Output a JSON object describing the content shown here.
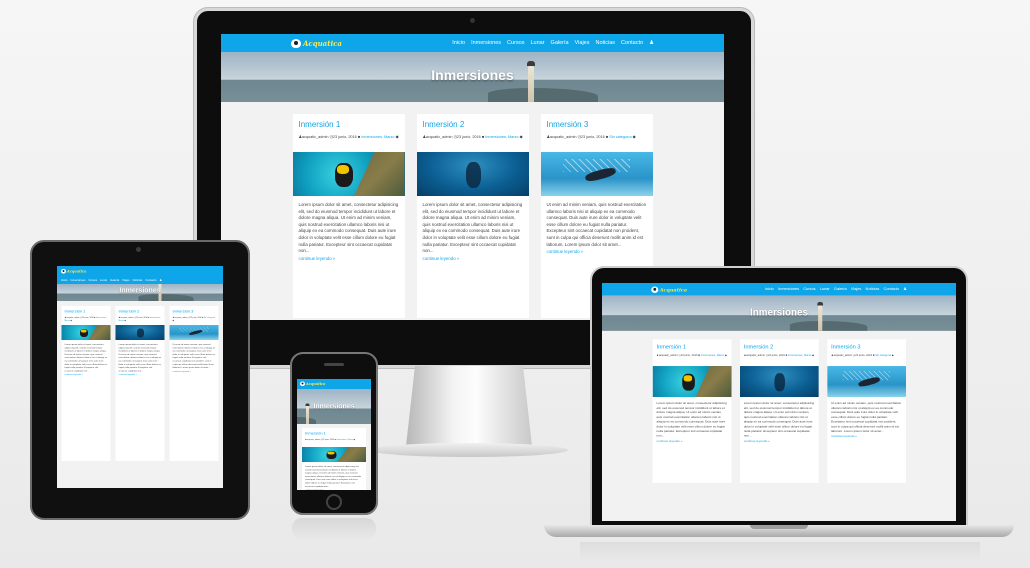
{
  "site": {
    "logo_text": "Acquatica",
    "logo_icon": "fish-logo-icon",
    "nav": [
      "Inicio",
      "Inmersiones",
      "Cursos",
      "Lunar",
      "Galería",
      "Viajes",
      "Noticias",
      "Contacto"
    ],
    "nav_user_icon": "user-icon",
    "page_title": "Inmersiones",
    "posts": [
      {
        "title": "Inmersión 1",
        "author": "acquatic_admin",
        "date": "23 junio, 2016",
        "categories": "Inmersiones, Marzo",
        "excerpt": "Lorem ipsum dolor sit amet, consectetur adipisicing elit, sed do eiusmod tempor incididunt ut labore et dolore magna aliqua. Ut enim ad minim veniam, quis nostrud exercitation ullamco laboris nisi ut aliquip ex ea commodo consequat. Duis aute irure dolor in voluptate velit esse cillum dolore eu fugiat nulla pariatur. Excepteur sint occaecat cupidatat non...",
        "more": "continue leyendo »"
      },
      {
        "title": "Inmersión 2",
        "author": "acquatic_admin",
        "date": "23 junio, 2016",
        "categories": "Inmersiones, Marzo",
        "excerpt": "Lorem ipsum dolor sit amet, consectetur adipisicing elit, sed do eiusmod tempor incididunt ut labore et dolore magna aliqua. Ut enim ad minim veniam, quis nostrud exercitation ullamco laboris nisi ut aliquip ex ea commodo consequat. Duis aute irure dolor in voluptate velit esse cillum dolore eu fugiat nulla pariatur. Excepteur sint occaecat cupidatat non...",
        "more": "continue leyendo »"
      },
      {
        "title": "Inmersión 3",
        "author": "acquatic_admin",
        "date": "23 junio, 2016",
        "categories": "Sin categoría",
        "excerpt": "Ut enim ad minim veniam, quis nostrud exercitation ullamco laboris nisi ut aliquip ex ea commodo consequat. Duis aute irure dolor in voluptate velit esse cillum dolore eu fugiat nulla pariatur. Excepteur sint occaecat cupidatat non proident, sunt in culpa qui officia deserunt mollit anim id est laborum. Lorem ipsum dolor sit amet...",
        "more": "continue leyendo »"
      }
    ]
  },
  "colors": {
    "accent": "#0ea5e9",
    "logo": "#ffe94a"
  }
}
